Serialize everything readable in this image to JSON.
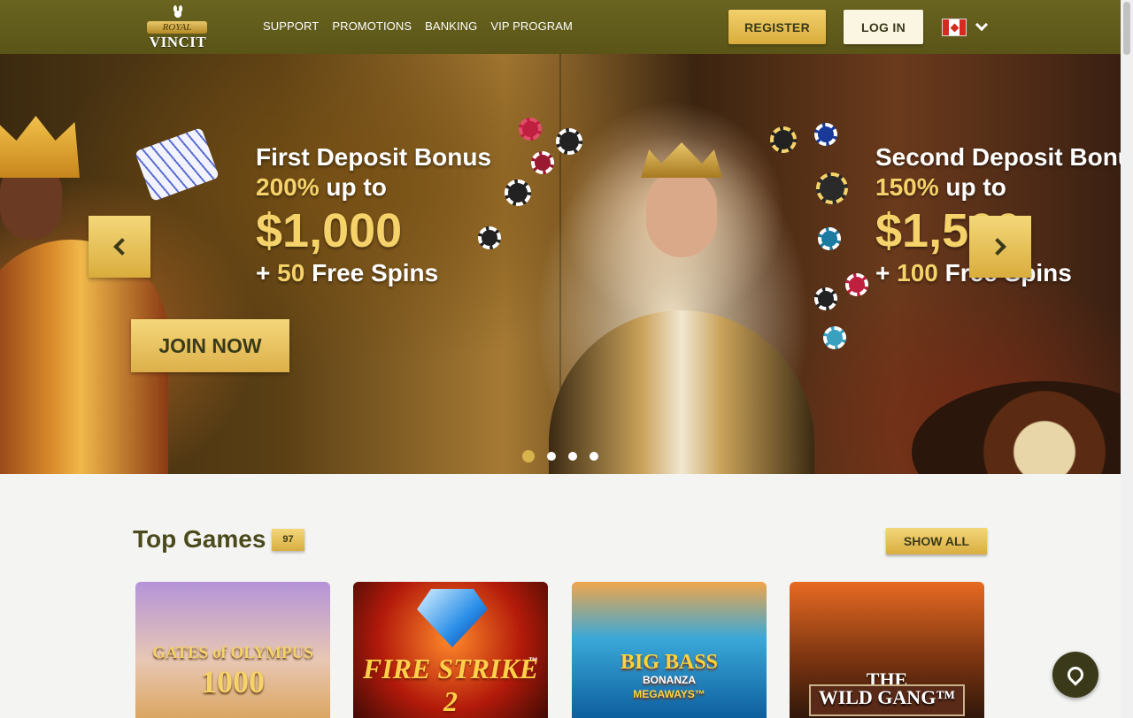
{
  "logo": {
    "top": "ROYAL",
    "word": "VINCIT"
  },
  "nav": [
    "SUPPORT",
    "PROMOTIONS",
    "BANKING",
    "VIP PROGRAM"
  ],
  "auth": {
    "register": "REGISTER",
    "login": "LOG IN"
  },
  "language": {
    "flag": "canada-flag-icon"
  },
  "hero": {
    "promos": [
      {
        "title": "First Deposit Bonus",
        "percent": "200%",
        "upto": " up to",
        "amount": "$1,000",
        "plus": "+ ",
        "spins_count": "50",
        "spins": " Free Spins"
      },
      {
        "title": "Second Deposit Bonus",
        "percent": "150%",
        "upto": " up to",
        "amount": "$1,500",
        "plus": "+ ",
        "spins_count": "100",
        "spins": " Free Spins"
      }
    ],
    "cta": "JOIN NOW",
    "slide_count": 4,
    "active_slide": 1
  },
  "top_games": {
    "title": "Top Games",
    "count": "97",
    "show_all": "SHOW ALL",
    "games": [
      {
        "name": "GATES of OLYMPUS",
        "subtitle": "1000"
      },
      {
        "name": "FIRE STRIKE 2",
        "tm": "™"
      },
      {
        "name": "BIG BASS",
        "sub1": "BONANZA",
        "sub2": "MEGAWAYS™"
      },
      {
        "name": "THE",
        "name2": "WILD GANG™"
      }
    ]
  },
  "colors": {
    "header": "#5e5819",
    "gold": "#d9ad3c",
    "title": "#4b4a1c"
  }
}
